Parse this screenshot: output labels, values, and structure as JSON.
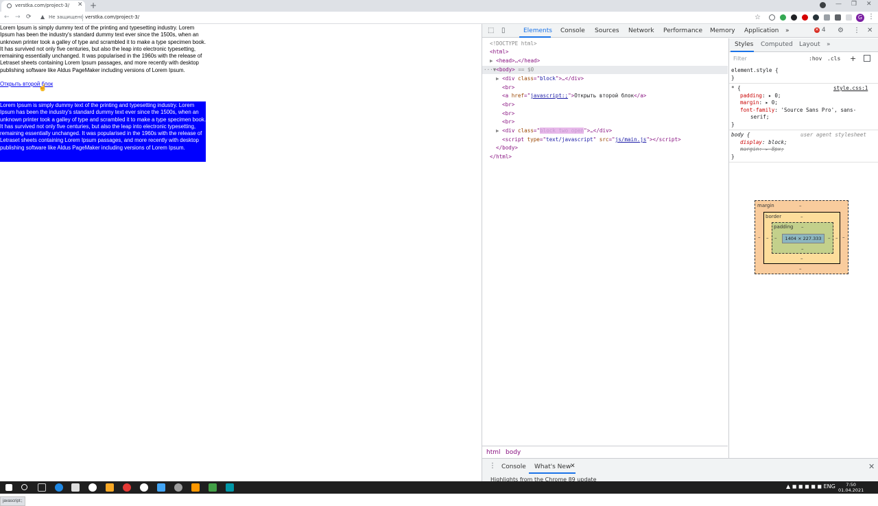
{
  "browser": {
    "tab_title": "verstka.com/project-3/",
    "tab_close": "✕",
    "new_tab": "+",
    "window_min": "—",
    "window_max": "❐",
    "window_close": "✕",
    "back": "←",
    "forward": "→",
    "reload": "⟳",
    "security_text": "Не защищено",
    "url": "verstka.com/project-3/",
    "avatar_letter": "G",
    "menu": "⋮",
    "status_url": "javascript:;"
  },
  "page": {
    "paragraph": "Lorem Ipsum is simply dummy text of the printing and typesetting industry. Lorem Ipsum has been the industry's standard dummy text ever since the 1500s, when an unknown printer took a galley of type and scrambled it to make a type specimen book. It has survived not only five centuries, but also the leap into electronic typesetting, remaining essentially unchanged. It was popularised in the 1960s with the release of Letraset sheets containing Lorem Ipsum passages, and more recently with desktop publishing software like Aldus PageMaker including versions of Lorem Ipsum.",
    "link_text": "Открыть второй блок",
    "blue_block_text": "Lorem Ipsum is simply dummy text of the printing and typesetting industry. Lorem Ipsum has been the industry's standard dummy text ever since the 1500s, when an unknown printer took a galley of type and scrambled it to make a type specimen book. It has survived not only five centuries, but also the leap into electronic typesetting, remaining essentially unchanged. It was popularised in the 1960s with the release of Letraset sheets containing Lorem Ipsum passages, and more recently with desktop publishing software like Aldus PageMaker including versions of Lorem Ipsum."
  },
  "devtools": {
    "tabs": [
      "Elements",
      "Console",
      "Sources",
      "Network",
      "Performance",
      "Memory",
      "Application"
    ],
    "more_tabs": "»",
    "error_count": "4",
    "settings": "⚙",
    "menu": "⋮",
    "close": "✕",
    "dom": {
      "doctype": "<!DOCTYPE html>",
      "html_open": "<html>",
      "head": "<head>…</head>",
      "body_open": "<body>",
      "body_marker": "== $0",
      "div_block_tag": "div",
      "div_block_attr": "class",
      "div_block_val": "block",
      "br": "<br>",
      "a_tag": "a",
      "a_attr": "href",
      "a_href": "javascript:;",
      "a_text": "Открыть второй блок",
      "div2_val": "block two open",
      "script_type_val": "text/javascript",
      "script_src_val": "js/main.js",
      "body_close": "</body>",
      "html_close": "</html>"
    },
    "breadcrumbs": [
      "html",
      "body"
    ],
    "styles_tabs": [
      "Styles",
      "Computed",
      "Layout"
    ],
    "filter_placeholder": "Filter",
    "hov": ":hov",
    "cls": ".cls",
    "rules": {
      "element_style": "element.style {",
      "close_brace": "}",
      "star_selector": "* {",
      "star_source": "style.css:1",
      "padding_name": "padding",
      "padding_value": "0;",
      "margin_name": "margin",
      "margin_value": "0;",
      "font_family_name": "font-family",
      "font_family_value": "'Source Sans Pro', sans-",
      "font_family_value2": "serif;",
      "body_selector": "body {",
      "ua_label": "user agent stylesheet",
      "display_name": "display",
      "display_value": "block;",
      "ua_margin_name": "margin",
      "ua_margin_value": "8px;"
    },
    "box_model": {
      "margin_label": "margin",
      "border_label": "border",
      "padding_label": "padding",
      "dash": "–",
      "content_size": "1404 × 227.333"
    },
    "drawer": {
      "console": "Console",
      "whats_new": "What's New",
      "close": "✕",
      "text": "Highlights from the Chrome 89 update"
    }
  },
  "taskbar": {
    "language": "ENG",
    "time": "7:50",
    "date": "01.04.2021"
  }
}
